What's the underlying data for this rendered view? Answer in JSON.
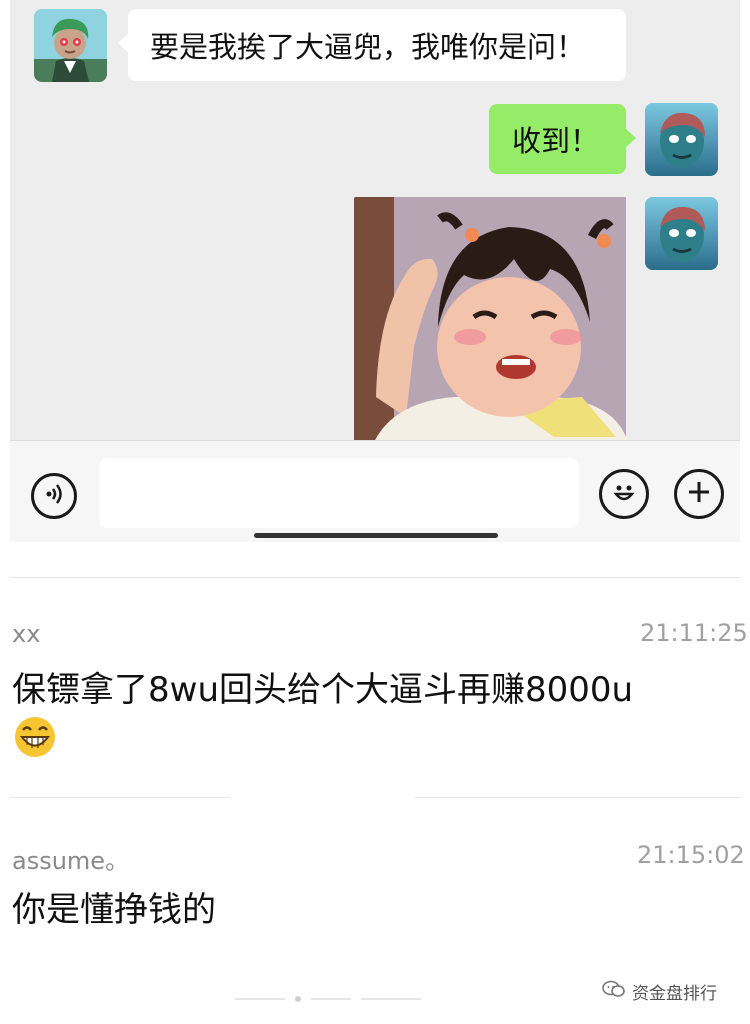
{
  "chat": {
    "incoming_message": "要是我挨了大逼兜，我唯你是问！",
    "outgoing_message": "收到！",
    "sticker": {
      "description": "girl-salute-sticker"
    },
    "input": {
      "placeholder": ""
    },
    "icons": {
      "voice": "voice-icon",
      "emoji": "emoji-icon",
      "plus": "plus-icon"
    },
    "colors": {
      "background": "#ededed",
      "outgoing_bubble": "#95ec69",
      "incoming_bubble": "#ffffff"
    }
  },
  "comments": [
    {
      "user": "xx",
      "time": "21:11:25",
      "text": "保镖拿了8wu回头给个大逼斗再赚8000u",
      "emoji": "grinning-face-emoji"
    },
    {
      "user": "assume。",
      "time": "21:15:02",
      "text": "你是懂挣钱的"
    }
  ],
  "watermark": {
    "text": "资金盘排行",
    "icon": "wechat-official-icon"
  }
}
